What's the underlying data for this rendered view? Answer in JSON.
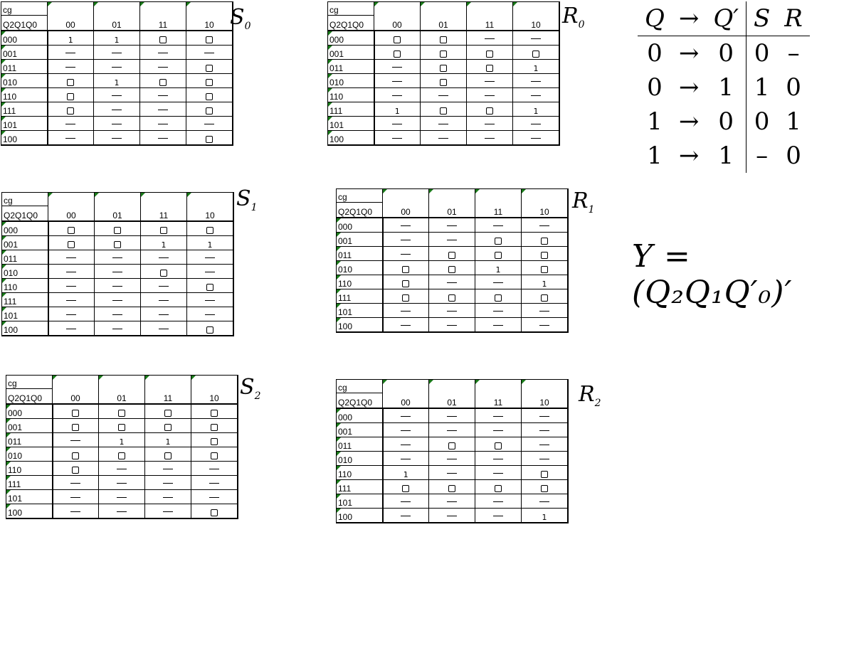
{
  "kmaps": [
    {
      "id": "s0",
      "label": "S",
      "label_sub": "0",
      "corner_top": "cg",
      "corner_bottom": "Q2Q1Q0",
      "cols": [
        "00",
        "01",
        "11",
        "10"
      ],
      "rows": [
        "000",
        "001",
        "011",
        "010",
        "110",
        "111",
        "101",
        "100"
      ],
      "cells": [
        [
          "1",
          "1",
          "0",
          "0"
        ],
        [
          "-",
          "-",
          "-",
          "-"
        ],
        [
          "-",
          "-",
          "-",
          "0"
        ],
        [
          "0",
          "1",
          "0",
          "0"
        ],
        [
          "0",
          "-",
          "-",
          "0"
        ],
        [
          "0",
          "-",
          "-",
          "0"
        ],
        [
          "-",
          "-",
          "-",
          "-"
        ],
        [
          "-",
          "-",
          "-",
          "0"
        ]
      ]
    },
    {
      "id": "r0",
      "label": "R",
      "label_sub": "0",
      "corner_top": "cg",
      "corner_bottom": "Q2Q1Q0",
      "cols": [
        "00",
        "01",
        "11",
        "10"
      ],
      "rows": [
        "000",
        "001",
        "011",
        "010",
        "110",
        "111",
        "101",
        "100"
      ],
      "cells": [
        [
          "0",
          "0",
          "-",
          "-"
        ],
        [
          "0",
          "0",
          "0",
          "0"
        ],
        [
          "-",
          "0",
          "0",
          "1"
        ],
        [
          "-",
          "0",
          "-",
          "-"
        ],
        [
          "-",
          "-",
          "-",
          "-"
        ],
        [
          "1",
          "0",
          "0",
          "1"
        ],
        [
          "-",
          "-",
          "-",
          "-"
        ],
        [
          "-",
          "-",
          "-",
          "-"
        ]
      ]
    },
    {
      "id": "s1",
      "label": "S",
      "label_sub": "1",
      "corner_top": "cg",
      "corner_bottom": "Q2Q1Q0",
      "cols": [
        "00",
        "01",
        "11",
        "10"
      ],
      "rows": [
        "000",
        "001",
        "011",
        "010",
        "110",
        "111",
        "101",
        "100"
      ],
      "cells": [
        [
          "0",
          "0",
          "0",
          "0"
        ],
        [
          "0",
          "0",
          "1",
          "1"
        ],
        [
          "-",
          "-",
          "-",
          "-"
        ],
        [
          "-",
          "-",
          "0",
          "-"
        ],
        [
          "-",
          "-",
          "-",
          "0"
        ],
        [
          "-",
          "-",
          "-",
          "-"
        ],
        [
          "-",
          "-",
          "-",
          "-"
        ],
        [
          "-",
          "-",
          "-",
          "0"
        ]
      ]
    },
    {
      "id": "r1",
      "label": "R",
      "label_sub": "1",
      "corner_top": "cg",
      "corner_bottom": "Q2Q1Q0",
      "cols": [
        "00",
        "01",
        "11",
        "10"
      ],
      "rows": [
        "000",
        "001",
        "011",
        "010",
        "110",
        "111",
        "101",
        "100"
      ],
      "cells": [
        [
          "-",
          "-",
          "-",
          "-"
        ],
        [
          "-",
          "-",
          "0",
          "0"
        ],
        [
          "-",
          "0",
          "0",
          "0"
        ],
        [
          "0",
          "0",
          "1",
          "0"
        ],
        [
          "0",
          "-",
          "-",
          "1"
        ],
        [
          "0",
          "0",
          "0",
          "0"
        ],
        [
          "-",
          "-",
          "-",
          "-"
        ],
        [
          "-",
          "-",
          "-",
          "-"
        ]
      ]
    },
    {
      "id": "s2",
      "label": "S",
      "label_sub": "2",
      "corner_top": "cg",
      "corner_bottom": "Q2Q1Q0",
      "cols": [
        "00",
        "01",
        "11",
        "10"
      ],
      "rows": [
        "000",
        "001",
        "011",
        "010",
        "110",
        "111",
        "101",
        "100"
      ],
      "cells": [
        [
          "0",
          "0",
          "0",
          "0"
        ],
        [
          "0",
          "0",
          "0",
          "0"
        ],
        [
          "-",
          "1",
          "1",
          "0"
        ],
        [
          "0",
          "0",
          "0",
          "0"
        ],
        [
          "0",
          "-",
          "-",
          "-"
        ],
        [
          "-",
          "-",
          "-",
          "-"
        ],
        [
          "-",
          "-",
          "-",
          "-"
        ],
        [
          "-",
          "-",
          "-",
          "0"
        ]
      ]
    },
    {
      "id": "r2",
      "label": "R",
      "label_sub": "2",
      "corner_top": "cg",
      "corner_bottom": "Q2Q1Q0",
      "cols": [
        "00",
        "01",
        "11",
        "10"
      ],
      "rows": [
        "000",
        "001",
        "011",
        "010",
        "110",
        "111",
        "101",
        "100"
      ],
      "cells": [
        [
          "-",
          "-",
          "-",
          "-"
        ],
        [
          "-",
          "-",
          "-",
          "-"
        ],
        [
          "-",
          "0",
          "0",
          "-"
        ],
        [
          "-",
          "-",
          "-",
          "-"
        ],
        [
          "1",
          "-",
          "-",
          "0"
        ],
        [
          "0",
          "0",
          "0",
          "0"
        ],
        [
          "-",
          "-",
          "-",
          "-"
        ],
        [
          "-",
          "-",
          "-",
          "1"
        ]
      ]
    }
  ],
  "truth_table": {
    "headers": [
      "Q",
      "→",
      "Q′",
      "S",
      "R"
    ],
    "rows": [
      [
        "0",
        "→",
        "0",
        "0",
        "–"
      ],
      [
        "0",
        "→",
        "1",
        "1",
        "0"
      ],
      [
        "1",
        "→",
        "0",
        "0",
        "1"
      ],
      [
        "1",
        "→",
        "1",
        "–",
        "0"
      ]
    ]
  },
  "equation": {
    "text": "Y = (Q₂Q₁Q′₀)′"
  },
  "colors": {
    "cell_flag": "#1a7a1a",
    "grid": "#000000",
    "background": "#ffffff"
  }
}
